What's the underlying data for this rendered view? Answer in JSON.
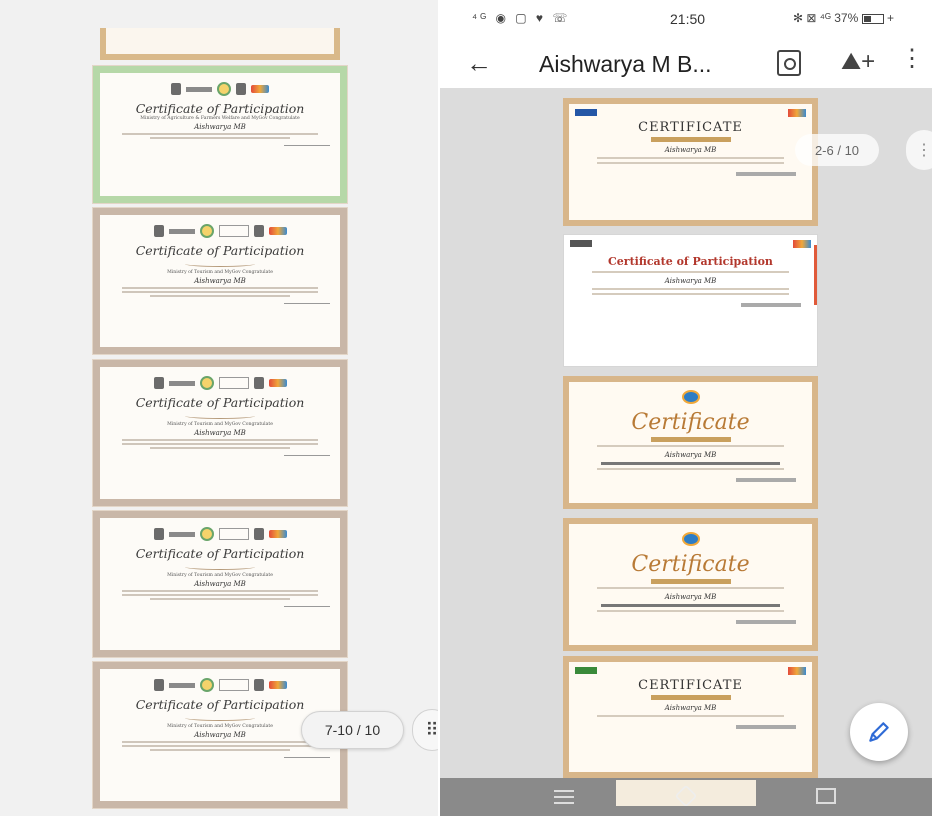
{
  "left_viewer": {
    "page_counter": "7-10 / 10",
    "certificates": [
      {
        "title": "Certificate of Participation",
        "recipient": "Aishwarya MB",
        "ministry": "Ministry of Agriculture & Farmers Welfare and MyGov Congratulate"
      },
      {
        "title": "Certificate of Participation",
        "recipient": "Aishwarya MB",
        "ministry": "Ministry of Tourism and MyGov Congratulate"
      },
      {
        "title": "Certificate of Participation",
        "recipient": "Aishwarya MB",
        "ministry": "Ministry of Tourism and MyGov Congratulate"
      },
      {
        "title": "Certificate of Participation",
        "recipient": "Aishwarya MB",
        "ministry": "Ministry of Tourism and MyGov Congratulate"
      },
      {
        "title": "Certificate of Participation",
        "recipient": "Aishwarya MB",
        "ministry": "Ministry of Tourism and MyGov Congratulate"
      }
    ]
  },
  "status_bar": {
    "left_icons": "⁴ᴳ ◉ ▢ ♥ ☏",
    "time": "21:50",
    "right_icons": "✻ ⊠ ⁴ᴳ 37%"
  },
  "app_bar": {
    "back_icon": "←",
    "title": "Aishwarya M B...",
    "drive_icon": "⛰+",
    "more_icon": "⋮"
  },
  "right_viewer": {
    "page_counter": "2-6 / 10",
    "counter_menu": "⋮",
    "certificates": [
      {
        "title": "CERTIFICATE",
        "recipient": "Aishwarya MB"
      },
      {
        "title": "Certificate of Participation",
        "recipient": "Aishwarya MB"
      },
      {
        "title": "Certificate",
        "recipient": "Aishwarya MB"
      },
      {
        "title": "Certificate",
        "recipient": "Aishwarya MB"
      },
      {
        "title": "CERTIFICATE",
        "recipient": "Aishwarya MB"
      }
    ]
  },
  "icons": {
    "grid": "⠿",
    "edit": "✎"
  }
}
